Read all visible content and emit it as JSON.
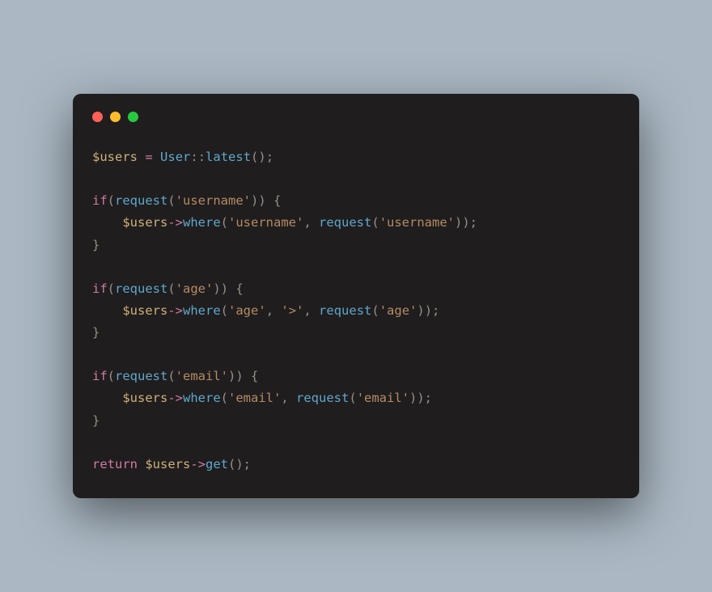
{
  "window": {
    "traffic_lights": {
      "close": "close",
      "minimize": "minimize",
      "zoom": "zoom"
    }
  },
  "code": {
    "language": "php",
    "tokens": [
      {
        "t": "var",
        "v": "$users"
      },
      {
        "t": "txt",
        "v": " "
      },
      {
        "t": "op",
        "v": "="
      },
      {
        "t": "txt",
        "v": " "
      },
      {
        "t": "class",
        "v": "User"
      },
      {
        "t": "punct",
        "v": "::"
      },
      {
        "t": "fn",
        "v": "latest"
      },
      {
        "t": "punct",
        "v": "();"
      },
      {
        "t": "nl"
      },
      {
        "t": "nl"
      },
      {
        "t": "kw",
        "v": "if"
      },
      {
        "t": "punct",
        "v": "("
      },
      {
        "t": "fn",
        "v": "request"
      },
      {
        "t": "punct",
        "v": "("
      },
      {
        "t": "string",
        "v": "'username'"
      },
      {
        "t": "punct",
        "v": ")) {"
      },
      {
        "t": "nl"
      },
      {
        "t": "txt",
        "v": "    "
      },
      {
        "t": "var",
        "v": "$users"
      },
      {
        "t": "op",
        "v": "->"
      },
      {
        "t": "fn",
        "v": "where"
      },
      {
        "t": "punct",
        "v": "("
      },
      {
        "t": "string",
        "v": "'username'"
      },
      {
        "t": "punct",
        "v": ", "
      },
      {
        "t": "fn",
        "v": "request"
      },
      {
        "t": "punct",
        "v": "("
      },
      {
        "t": "string",
        "v": "'username'"
      },
      {
        "t": "punct",
        "v": "));"
      },
      {
        "t": "nl"
      },
      {
        "t": "punct",
        "v": "}"
      },
      {
        "t": "nl"
      },
      {
        "t": "nl"
      },
      {
        "t": "kw",
        "v": "if"
      },
      {
        "t": "punct",
        "v": "("
      },
      {
        "t": "fn",
        "v": "request"
      },
      {
        "t": "punct",
        "v": "("
      },
      {
        "t": "string",
        "v": "'age'"
      },
      {
        "t": "punct",
        "v": ")) {"
      },
      {
        "t": "nl"
      },
      {
        "t": "txt",
        "v": "    "
      },
      {
        "t": "var",
        "v": "$users"
      },
      {
        "t": "op",
        "v": "->"
      },
      {
        "t": "fn",
        "v": "where"
      },
      {
        "t": "punct",
        "v": "("
      },
      {
        "t": "string",
        "v": "'age'"
      },
      {
        "t": "punct",
        "v": ", "
      },
      {
        "t": "string",
        "v": "'>'"
      },
      {
        "t": "punct",
        "v": ", "
      },
      {
        "t": "fn",
        "v": "request"
      },
      {
        "t": "punct",
        "v": "("
      },
      {
        "t": "string",
        "v": "'age'"
      },
      {
        "t": "punct",
        "v": "));"
      },
      {
        "t": "nl"
      },
      {
        "t": "punct",
        "v": "}"
      },
      {
        "t": "nl"
      },
      {
        "t": "nl"
      },
      {
        "t": "kw",
        "v": "if"
      },
      {
        "t": "punct",
        "v": "("
      },
      {
        "t": "fn",
        "v": "request"
      },
      {
        "t": "punct",
        "v": "("
      },
      {
        "t": "string",
        "v": "'email'"
      },
      {
        "t": "punct",
        "v": ")) {"
      },
      {
        "t": "nl"
      },
      {
        "t": "txt",
        "v": "    "
      },
      {
        "t": "var",
        "v": "$users"
      },
      {
        "t": "op",
        "v": "->"
      },
      {
        "t": "fn",
        "v": "where"
      },
      {
        "t": "punct",
        "v": "("
      },
      {
        "t": "string",
        "v": "'email'"
      },
      {
        "t": "punct",
        "v": ", "
      },
      {
        "t": "fn",
        "v": "request"
      },
      {
        "t": "punct",
        "v": "("
      },
      {
        "t": "string",
        "v": "'email'"
      },
      {
        "t": "punct",
        "v": "));"
      },
      {
        "t": "nl"
      },
      {
        "t": "punct",
        "v": "}"
      },
      {
        "t": "nl"
      },
      {
        "t": "nl"
      },
      {
        "t": "kw",
        "v": "return"
      },
      {
        "t": "txt",
        "v": " "
      },
      {
        "t": "var",
        "v": "$users"
      },
      {
        "t": "op",
        "v": "->"
      },
      {
        "t": "fn",
        "v": "get"
      },
      {
        "t": "punct",
        "v": "();"
      }
    ]
  }
}
